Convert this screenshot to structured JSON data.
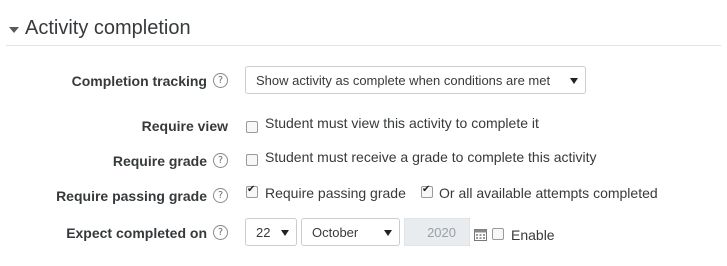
{
  "section": {
    "title": "Activity completion"
  },
  "fields": {
    "completion_tracking": {
      "label": "Completion tracking",
      "value": "Show activity as complete when conditions are met"
    },
    "require_view": {
      "label": "Require view",
      "checkbox_label": "Student must view this activity to complete it",
      "checked": false
    },
    "require_grade": {
      "label": "Require grade",
      "checkbox_label": "Student must receive a grade to complete this activity",
      "checked": false
    },
    "require_passing_grade": {
      "label": "Require passing grade",
      "option1": {
        "label": "Require passing grade",
        "checked": true
      },
      "option2": {
        "label": "Or all available attempts completed",
        "checked": true
      }
    },
    "expect_completed_on": {
      "label": "Expect completed on",
      "day": "22",
      "month": "October",
      "year": "2020",
      "enable_label": "Enable",
      "enabled": false
    }
  },
  "help_icon_glyph": "?",
  "icons": [
    "collapse-triangle-icon",
    "help-icon",
    "calendar-icon",
    "dropdown-arrow-icon"
  ]
}
